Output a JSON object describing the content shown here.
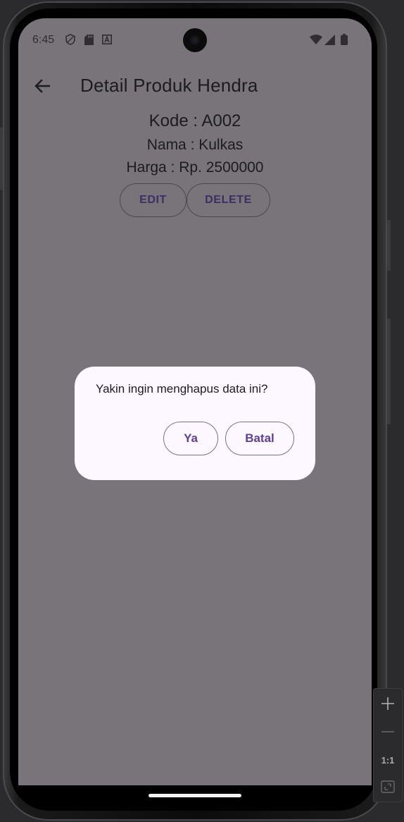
{
  "status_bar": {
    "time": "6:45",
    "left_icons": [
      "shield-icon",
      "sd-card-icon",
      "font-a-icon"
    ],
    "right_icons": [
      "wifi-icon",
      "cellular-signal-icon",
      "battery-icon"
    ]
  },
  "app_bar": {
    "back_icon": "arrow-left-icon",
    "title": "Detail Produk Hendra"
  },
  "product": {
    "kode": "Kode : A002",
    "nama": "Nama : Kulkas",
    "harga": "Harga : Rp. 2500000"
  },
  "actions": {
    "edit_label": "EDIT",
    "delete_label": "DELETE"
  },
  "dialog": {
    "message": "Yakin ingin menghapus data ini?",
    "confirm_label": "Ya",
    "cancel_label": "Batal"
  },
  "emulator_toolbar": {
    "zoom_in_icon": "plus-icon",
    "zoom_out_icon": "minus-icon",
    "actual_size_label": "1:1",
    "fit_screen_icon": "fit-screen-icon"
  },
  "colors": {
    "scrim_background": "#787479",
    "dialog_surface": "#fdf7ff",
    "button_text": "#5c3f9a"
  }
}
